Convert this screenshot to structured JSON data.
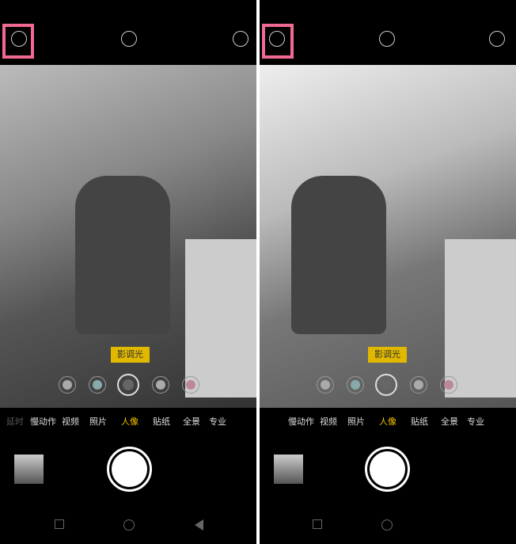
{
  "panels": [
    {
      "badge": "影调光",
      "modes": [
        "延时",
        "慢动作",
        "视频",
        "照片",
        "人像",
        "贴纸",
        "全景",
        "专业"
      ],
      "active_mode": "人像",
      "selected_filter": 2
    },
    {
      "badge": "影调光",
      "modes": [
        "慢动作",
        "视频",
        "照片",
        "人像",
        "贴纸",
        "全景",
        "专业"
      ],
      "active_mode": "人像",
      "selected_filter": 3
    }
  ],
  "icons": {
    "top": [
      "portrait-icon",
      "aperture-icon",
      "filter-reel-icon"
    ],
    "nav": [
      "recent-apps-icon",
      "home-icon",
      "back-icon"
    ]
  },
  "colors": {
    "accent": "#f0c000",
    "highlight": "#f06a92",
    "badge": "#e0b800"
  }
}
